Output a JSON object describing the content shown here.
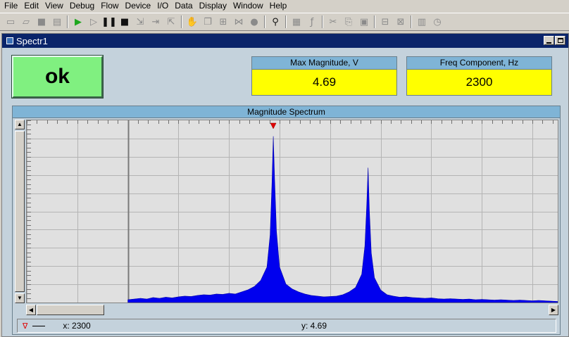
{
  "menu": {
    "items": [
      "File",
      "Edit",
      "View",
      "Debug",
      "Flow",
      "Device",
      "I/O",
      "Data",
      "Display",
      "Window",
      "Help"
    ]
  },
  "toolbar": {
    "groups": [
      [
        "new-icon",
        "open-icon",
        "save-icon",
        "print-icon"
      ],
      [
        "run-icon",
        "step-run-icon",
        "pause-icon",
        "stop-icon",
        "step-into-icon",
        "step-over-icon",
        "step-out-icon"
      ],
      [
        "hand-icon",
        "copy-block-icon",
        "connect-icon",
        "network-icon",
        "record-icon"
      ],
      [
        "binoculars-icon"
      ],
      [
        "properties-icon",
        "function-icon"
      ],
      [
        "cut-icon",
        "copy-icon",
        "paste-icon"
      ],
      [
        "align-icon",
        "distribute-icon"
      ],
      [
        "panel-icon",
        "clock-icon"
      ]
    ]
  },
  "window": {
    "title": "Spectr1"
  },
  "ok_button": {
    "label": "ok",
    "color": "#80f080"
  },
  "indicators": {
    "max_magnitude": {
      "label": "Max Magnitude, V",
      "value": "4.69"
    },
    "freq_component": {
      "label": "Freq Component, Hz",
      "value": "2300"
    }
  },
  "colors": {
    "indicator_bg": "#ffff00",
    "header_bg": "#7fb4d6",
    "spectrum_fill": "#0000ee",
    "marker": "#e00000"
  },
  "chart_data": {
    "type": "area",
    "title": "Magnitude Spectrum",
    "xlabel": "",
    "ylabel": "",
    "grid": true,
    "x": [
      0,
      100,
      200,
      300,
      400,
      500,
      600,
      700,
      800,
      900,
      1000,
      1100,
      1200,
      1300,
      1400,
      1500,
      1600,
      1700,
      1800,
      1900,
      2000,
      2100,
      2200,
      2250,
      2280,
      2300,
      2320,
      2350,
      2400,
      2500,
      2600,
      2700,
      2800,
      2900,
      3000,
      3100,
      3200,
      3300,
      3400,
      3500,
      3600,
      3700,
      3750,
      3780,
      3800,
      3820,
      3850,
      3900,
      4000,
      4100,
      4200,
      4300,
      4400,
      4500,
      4600,
      4700,
      4800,
      4900,
      5000,
      5100,
      5200,
      5300,
      5400,
      5500,
      5600,
      5700,
      5800,
      5900,
      6000,
      6100,
      6200,
      6300,
      6400,
      6500,
      6600,
      6700,
      6800
    ],
    "y": [
      0.08,
      0.1,
      0.12,
      0.1,
      0.14,
      0.12,
      0.15,
      0.13,
      0.16,
      0.18,
      0.17,
      0.2,
      0.22,
      0.21,
      0.24,
      0.23,
      0.26,
      0.24,
      0.3,
      0.36,
      0.45,
      0.62,
      1.0,
      1.9,
      3.4,
      4.69,
      3.5,
      2.0,
      1.0,
      0.52,
      0.38,
      0.3,
      0.24,
      0.2,
      0.18,
      0.16,
      0.17,
      0.18,
      0.22,
      0.3,
      0.42,
      0.8,
      1.6,
      2.8,
      3.8,
      2.6,
      1.4,
      0.7,
      0.35,
      0.22,
      0.18,
      0.15,
      0.16,
      0.14,
      0.13,
      0.12,
      0.13,
      0.11,
      0.1,
      0.11,
      0.1,
      0.09,
      0.1,
      0.08,
      0.09,
      0.08,
      0.07,
      0.08,
      0.07,
      0.06,
      0.07,
      0.06,
      0.05,
      0.06,
      0.05,
      0.04,
      0.03
    ],
    "xlim": [
      -1600,
      6800
    ],
    "ylim": [
      0,
      4.9
    ],
    "marker": {
      "x": 2300,
      "y": 4.69
    }
  },
  "cursor_readout": {
    "symbol": "∇",
    "x_text": "x: 2300",
    "y_text": "y: 4.69"
  }
}
